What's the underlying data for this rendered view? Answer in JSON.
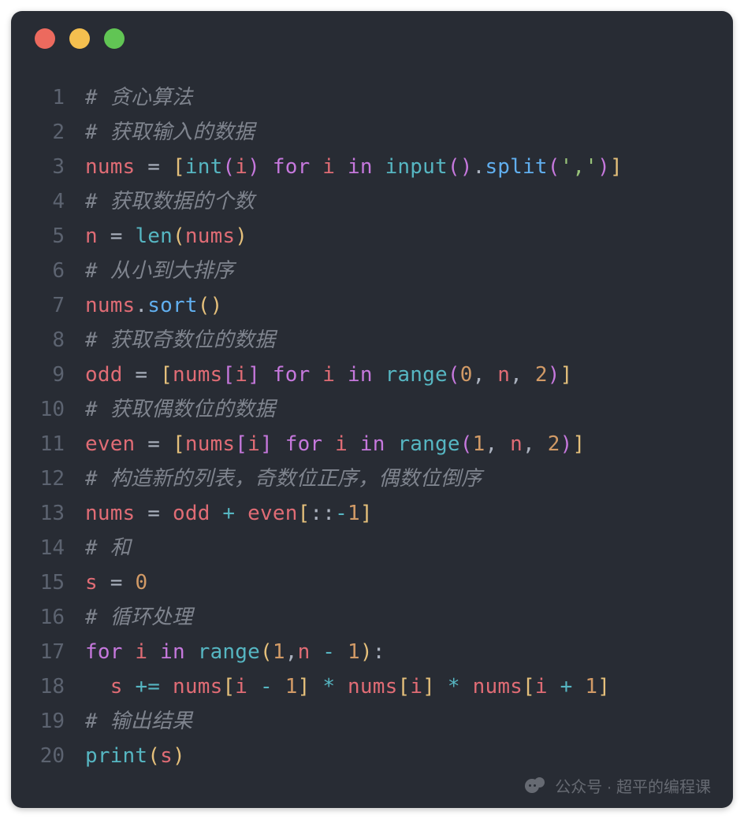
{
  "watermark": {
    "label": "公众号 · 超平的编程课"
  },
  "code": {
    "language": "python",
    "lines": [
      {
        "n": 1,
        "tokens": [
          {
            "t": "# 贪心算法",
            "c": "tok-comment"
          }
        ]
      },
      {
        "n": 2,
        "tokens": [
          {
            "t": "# 获取输入的数据",
            "c": "tok-comment"
          }
        ]
      },
      {
        "n": 3,
        "tokens": [
          {
            "t": "nums",
            "c": "tok-ident"
          },
          {
            "t": " ",
            "c": "tok-plain"
          },
          {
            "t": "=",
            "c": "tok-op"
          },
          {
            "t": " ",
            "c": "tok-plain"
          },
          {
            "t": "[",
            "c": "tok-br-y"
          },
          {
            "t": "int",
            "c": "tok-builtin"
          },
          {
            "t": "(",
            "c": "tok-br-p"
          },
          {
            "t": "i",
            "c": "tok-ident"
          },
          {
            "t": ")",
            "c": "tok-br-p"
          },
          {
            "t": " ",
            "c": "tok-plain"
          },
          {
            "t": "for",
            "c": "tok-kw"
          },
          {
            "t": " ",
            "c": "tok-plain"
          },
          {
            "t": "i",
            "c": "tok-ident"
          },
          {
            "t": " ",
            "c": "tok-plain"
          },
          {
            "t": "in",
            "c": "tok-kw"
          },
          {
            "t": " ",
            "c": "tok-plain"
          },
          {
            "t": "input",
            "c": "tok-builtin"
          },
          {
            "t": "(",
            "c": "tok-br-p"
          },
          {
            "t": ")",
            "c": "tok-br-p"
          },
          {
            "t": ".",
            "c": "tok-punct"
          },
          {
            "t": "split",
            "c": "tok-func"
          },
          {
            "t": "(",
            "c": "tok-br-p"
          },
          {
            "t": "','",
            "c": "tok-str"
          },
          {
            "t": ")",
            "c": "tok-br-p"
          },
          {
            "t": "]",
            "c": "tok-br-y"
          }
        ]
      },
      {
        "n": 4,
        "tokens": [
          {
            "t": "# 获取数据的个数",
            "c": "tok-comment"
          }
        ]
      },
      {
        "n": 5,
        "tokens": [
          {
            "t": "n",
            "c": "tok-ident"
          },
          {
            "t": " ",
            "c": "tok-plain"
          },
          {
            "t": "=",
            "c": "tok-op"
          },
          {
            "t": " ",
            "c": "tok-plain"
          },
          {
            "t": "len",
            "c": "tok-builtin"
          },
          {
            "t": "(",
            "c": "tok-br-y"
          },
          {
            "t": "nums",
            "c": "tok-ident"
          },
          {
            "t": ")",
            "c": "tok-br-y"
          }
        ]
      },
      {
        "n": 6,
        "tokens": [
          {
            "t": "# 从小到大排序",
            "c": "tok-comment"
          }
        ]
      },
      {
        "n": 7,
        "tokens": [
          {
            "t": "nums",
            "c": "tok-ident"
          },
          {
            "t": ".",
            "c": "tok-punct"
          },
          {
            "t": "sort",
            "c": "tok-func"
          },
          {
            "t": "(",
            "c": "tok-br-y"
          },
          {
            "t": ")",
            "c": "tok-br-y"
          }
        ]
      },
      {
        "n": 8,
        "tokens": [
          {
            "t": "# 获取奇数位的数据",
            "c": "tok-comment"
          }
        ]
      },
      {
        "n": 9,
        "tokens": [
          {
            "t": "odd",
            "c": "tok-ident"
          },
          {
            "t": " ",
            "c": "tok-plain"
          },
          {
            "t": "=",
            "c": "tok-op"
          },
          {
            "t": " ",
            "c": "tok-plain"
          },
          {
            "t": "[",
            "c": "tok-br-y"
          },
          {
            "t": "nums",
            "c": "tok-ident"
          },
          {
            "t": "[",
            "c": "tok-br-p"
          },
          {
            "t": "i",
            "c": "tok-ident"
          },
          {
            "t": "]",
            "c": "tok-br-p"
          },
          {
            "t": " ",
            "c": "tok-plain"
          },
          {
            "t": "for",
            "c": "tok-kw"
          },
          {
            "t": " ",
            "c": "tok-plain"
          },
          {
            "t": "i",
            "c": "tok-ident"
          },
          {
            "t": " ",
            "c": "tok-plain"
          },
          {
            "t": "in",
            "c": "tok-kw"
          },
          {
            "t": " ",
            "c": "tok-plain"
          },
          {
            "t": "range",
            "c": "tok-builtin"
          },
          {
            "t": "(",
            "c": "tok-br-p"
          },
          {
            "t": "0",
            "c": "tok-num"
          },
          {
            "t": ", ",
            "c": "tok-punct"
          },
          {
            "t": "n",
            "c": "tok-ident"
          },
          {
            "t": ", ",
            "c": "tok-punct"
          },
          {
            "t": "2",
            "c": "tok-num"
          },
          {
            "t": ")",
            "c": "tok-br-p"
          },
          {
            "t": "]",
            "c": "tok-br-y"
          }
        ]
      },
      {
        "n": 10,
        "tokens": [
          {
            "t": "# 获取偶数位的数据",
            "c": "tok-comment"
          }
        ]
      },
      {
        "n": 11,
        "tokens": [
          {
            "t": "even",
            "c": "tok-ident"
          },
          {
            "t": " ",
            "c": "tok-plain"
          },
          {
            "t": "=",
            "c": "tok-op"
          },
          {
            "t": " ",
            "c": "tok-plain"
          },
          {
            "t": "[",
            "c": "tok-br-y"
          },
          {
            "t": "nums",
            "c": "tok-ident"
          },
          {
            "t": "[",
            "c": "tok-br-p"
          },
          {
            "t": "i",
            "c": "tok-ident"
          },
          {
            "t": "]",
            "c": "tok-br-p"
          },
          {
            "t": " ",
            "c": "tok-plain"
          },
          {
            "t": "for",
            "c": "tok-kw"
          },
          {
            "t": " ",
            "c": "tok-plain"
          },
          {
            "t": "i",
            "c": "tok-ident"
          },
          {
            "t": " ",
            "c": "tok-plain"
          },
          {
            "t": "in",
            "c": "tok-kw"
          },
          {
            "t": " ",
            "c": "tok-plain"
          },
          {
            "t": "range",
            "c": "tok-builtin"
          },
          {
            "t": "(",
            "c": "tok-br-p"
          },
          {
            "t": "1",
            "c": "tok-num"
          },
          {
            "t": ", ",
            "c": "tok-punct"
          },
          {
            "t": "n",
            "c": "tok-ident"
          },
          {
            "t": ", ",
            "c": "tok-punct"
          },
          {
            "t": "2",
            "c": "tok-num"
          },
          {
            "t": ")",
            "c": "tok-br-p"
          },
          {
            "t": "]",
            "c": "tok-br-y"
          }
        ]
      },
      {
        "n": 12,
        "tokens": [
          {
            "t": "# 构造新的列表，奇数位正序，偶数位倒序",
            "c": "tok-comment"
          }
        ]
      },
      {
        "n": 13,
        "tokens": [
          {
            "t": "nums",
            "c": "tok-ident"
          },
          {
            "t": " ",
            "c": "tok-plain"
          },
          {
            "t": "=",
            "c": "tok-op"
          },
          {
            "t": " ",
            "c": "tok-plain"
          },
          {
            "t": "odd",
            "c": "tok-ident"
          },
          {
            "t": " ",
            "c": "tok-plain"
          },
          {
            "t": "+",
            "c": "tok-op2"
          },
          {
            "t": " ",
            "c": "tok-plain"
          },
          {
            "t": "even",
            "c": "tok-ident"
          },
          {
            "t": "[",
            "c": "tok-br-y"
          },
          {
            "t": ":",
            "c": "tok-punct"
          },
          {
            "t": ":",
            "c": "tok-punct"
          },
          {
            "t": "-",
            "c": "tok-op2"
          },
          {
            "t": "1",
            "c": "tok-num"
          },
          {
            "t": "]",
            "c": "tok-br-y"
          }
        ]
      },
      {
        "n": 14,
        "tokens": [
          {
            "t": "# 和",
            "c": "tok-comment"
          }
        ]
      },
      {
        "n": 15,
        "tokens": [
          {
            "t": "s",
            "c": "tok-ident"
          },
          {
            "t": " ",
            "c": "tok-plain"
          },
          {
            "t": "=",
            "c": "tok-op"
          },
          {
            "t": " ",
            "c": "tok-plain"
          },
          {
            "t": "0",
            "c": "tok-num"
          }
        ]
      },
      {
        "n": 16,
        "tokens": [
          {
            "t": "# 循环处理",
            "c": "tok-comment"
          }
        ]
      },
      {
        "n": 17,
        "tokens": [
          {
            "t": "for",
            "c": "tok-kw"
          },
          {
            "t": " ",
            "c": "tok-plain"
          },
          {
            "t": "i",
            "c": "tok-ident"
          },
          {
            "t": " ",
            "c": "tok-plain"
          },
          {
            "t": "in",
            "c": "tok-kw"
          },
          {
            "t": " ",
            "c": "tok-plain"
          },
          {
            "t": "range",
            "c": "tok-builtin"
          },
          {
            "t": "(",
            "c": "tok-br-y"
          },
          {
            "t": "1",
            "c": "tok-num"
          },
          {
            "t": ",",
            "c": "tok-punct"
          },
          {
            "t": "n",
            "c": "tok-ident"
          },
          {
            "t": " ",
            "c": "tok-plain"
          },
          {
            "t": "-",
            "c": "tok-op2"
          },
          {
            "t": " ",
            "c": "tok-plain"
          },
          {
            "t": "1",
            "c": "tok-num"
          },
          {
            "t": ")",
            "c": "tok-br-y"
          },
          {
            "t": ":",
            "c": "tok-punct"
          }
        ]
      },
      {
        "n": 18,
        "tokens": [
          {
            "t": "  ",
            "c": "tok-plain"
          },
          {
            "t": "s",
            "c": "tok-ident"
          },
          {
            "t": " ",
            "c": "tok-plain"
          },
          {
            "t": "+=",
            "c": "tok-op2"
          },
          {
            "t": " ",
            "c": "tok-plain"
          },
          {
            "t": "nums",
            "c": "tok-ident"
          },
          {
            "t": "[",
            "c": "tok-br-y"
          },
          {
            "t": "i",
            "c": "tok-ident"
          },
          {
            "t": " ",
            "c": "tok-plain"
          },
          {
            "t": "-",
            "c": "tok-op2"
          },
          {
            "t": " ",
            "c": "tok-plain"
          },
          {
            "t": "1",
            "c": "tok-num"
          },
          {
            "t": "]",
            "c": "tok-br-y"
          },
          {
            "t": " ",
            "c": "tok-plain"
          },
          {
            "t": "*",
            "c": "tok-op2"
          },
          {
            "t": " ",
            "c": "tok-plain"
          },
          {
            "t": "nums",
            "c": "tok-ident"
          },
          {
            "t": "[",
            "c": "tok-br-y"
          },
          {
            "t": "i",
            "c": "tok-ident"
          },
          {
            "t": "]",
            "c": "tok-br-y"
          },
          {
            "t": " ",
            "c": "tok-plain"
          },
          {
            "t": "*",
            "c": "tok-op2"
          },
          {
            "t": " ",
            "c": "tok-plain"
          },
          {
            "t": "nums",
            "c": "tok-ident"
          },
          {
            "t": "[",
            "c": "tok-br-y"
          },
          {
            "t": "i",
            "c": "tok-ident"
          },
          {
            "t": " ",
            "c": "tok-plain"
          },
          {
            "t": "+",
            "c": "tok-op2"
          },
          {
            "t": " ",
            "c": "tok-plain"
          },
          {
            "t": "1",
            "c": "tok-num"
          },
          {
            "t": "]",
            "c": "tok-br-y"
          }
        ]
      },
      {
        "n": 19,
        "tokens": [
          {
            "t": "# 输出结果",
            "c": "tok-comment"
          }
        ]
      },
      {
        "n": 20,
        "tokens": [
          {
            "t": "print",
            "c": "tok-builtin"
          },
          {
            "t": "(",
            "c": "tok-br-y"
          },
          {
            "t": "s",
            "c": "tok-ident"
          },
          {
            "t": ")",
            "c": "tok-br-y"
          }
        ]
      }
    ]
  }
}
